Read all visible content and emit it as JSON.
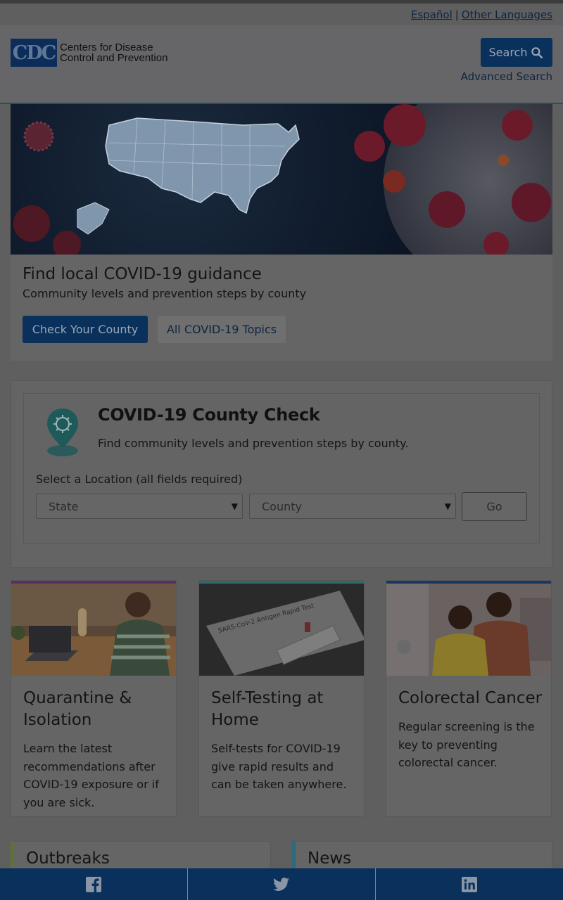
{
  "language_bar": {
    "espanol": "Español",
    "separator": "|",
    "other_languages": "Other Languages"
  },
  "header": {
    "logo_mark": "CDC",
    "logo_line1": "Centers for Disease",
    "logo_line2": "Control and Prevention",
    "search_label": "Search",
    "advanced_search": "Advanced Search"
  },
  "hero": {
    "title": "Find local COVID-19 guidance",
    "subtitle": "Community levels and prevention steps by county",
    "primary_button": "Check Your County",
    "secondary_button": "All COVID-19 Topics"
  },
  "county_check": {
    "title": "COVID-19 County Check",
    "description": "Find community levels and prevention steps by county.",
    "location_label": "Select a Location (all fields required)",
    "state_select": "State",
    "county_select": "County",
    "go_button": "Go",
    "icon": "location-pin-virus-icon"
  },
  "cards": [
    {
      "title": "Quarantine & Isolation",
      "description": "Learn the latest recommendations after COVID-19 exposure or if you are sick.",
      "accent": "#5a2d66"
    },
    {
      "title": "Self-Testing at Home",
      "description": "Self-tests for COVID-19 give rapid results and can be taken anywhere.",
      "accent": "#2e6a6c"
    },
    {
      "title": "Colorectal Cancer",
      "description": "Regular screening is the key to preventing colorectal cancer.",
      "accent": "#1a3764"
    }
  ],
  "sections": {
    "outbreaks": "Outbreaks",
    "news": "News",
    "outbreaks_accent": "#5c7432",
    "news_accent": "#2d6a7a"
  },
  "share": {
    "facebook_icon": "facebook-icon",
    "twitter_icon": "twitter-icon",
    "linkedin_icon": "linkedin-icon"
  },
  "colors": {
    "primary": "#0a305c",
    "overlay_background": "#5f5f5f"
  }
}
